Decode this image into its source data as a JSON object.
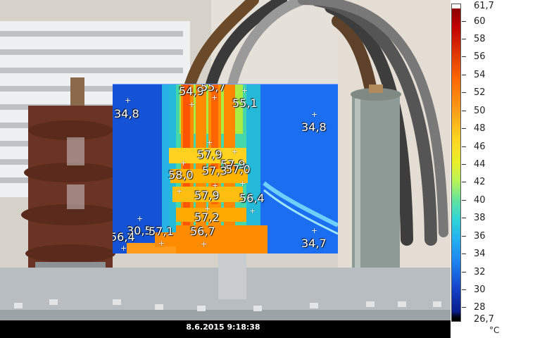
{
  "thermal_spots": [
    {
      "label": "54,9"
    },
    {
      "label": "55,7"
    },
    {
      "label": "55,1"
    },
    {
      "label": "34,8"
    },
    {
      "label": "34,8"
    },
    {
      "label": "57,9"
    },
    {
      "label": "57,9"
    },
    {
      "label": "57,0"
    },
    {
      "label": "58,0"
    },
    {
      "label": "57,3"
    },
    {
      "label": "57,9"
    },
    {
      "label": "56,4"
    },
    {
      "label": "57,2"
    },
    {
      "label": "30,5"
    },
    {
      "label": "57,1"
    },
    {
      "label": "56,7"
    },
    {
      "label": "56,4"
    },
    {
      "label": "34,7"
    }
  ],
  "status_bar": {
    "timestamp": "8.6.2015 9:18:38"
  },
  "color_scale": {
    "max_label": "61,7",
    "min_label": "26,7",
    "unit": "°C",
    "ticks": [
      "60",
      "58",
      "56",
      "54",
      "52",
      "50",
      "48",
      "46",
      "44",
      "42",
      "40",
      "38",
      "36",
      "34",
      "32",
      "30",
      "28"
    ]
  }
}
